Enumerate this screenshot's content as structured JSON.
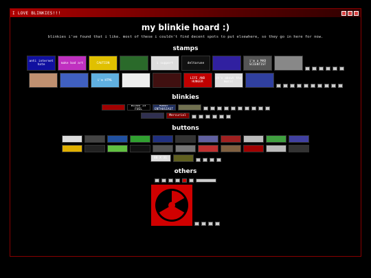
{
  "window": {
    "title": "I LOVE BLINKIES!!!"
  },
  "page": {
    "heading": "my blinkie hoard :)",
    "description": "blinkies i've found that i like. most of these i couldn't find decent spots to put elsewhere, so they go in here for now."
  },
  "sections": {
    "stamps": "stamps",
    "blinkies": "blinkies",
    "buttons": "buttons",
    "others": "others"
  },
  "stamps_row1": [
    {
      "text": "anti internet hate",
      "bg": "#1010a0"
    },
    {
      "text": "make bad art",
      "bg": "#c030c0"
    },
    {
      "text": "CAUTION",
      "bg": "#e0c000"
    },
    {
      "text": "",
      "bg": "#2a6a2a"
    },
    {
      "text": "i support",
      "bg": "#dddddd"
    },
    {
      "text": "deltarune",
      "bg": "#111"
    },
    {
      "text": "",
      "bg": "#3020a0"
    },
    {
      "text": "i'm a MAD SCIENTIST",
      "bg": "#555"
    },
    {
      "text": "",
      "bg": "#888"
    }
  ],
  "stamps_row2": [
    {
      "text": "",
      "bg": "#c09070"
    },
    {
      "text": "",
      "bg": "#4060c0"
    },
    {
      "text": "i'm HTML",
      "bg": "#60b0e0"
    },
    {
      "text": "",
      "bg": "#eee"
    },
    {
      "text": "",
      "bg": "#401010"
    },
    {
      "text": "LIFE AND HUNGER",
      "bg": "#c00000"
    },
    {
      "text": "it's about the music",
      "bg": "#e0e0e0"
    },
    {
      "text": "",
      "bg": "#3040a0"
    }
  ],
  "blinkies_row1": [
    {
      "text": "",
      "bg": "#a00000"
    },
    {
      "text": "BLOOD IS FUEL",
      "bg": "#000"
    },
    {
      "text": "ROBOT ENTHUSIAST",
      "bg": "#203060"
    },
    {
      "text": "",
      "bg": "#707050"
    }
  ],
  "blinkies_row2": [
    {
      "text": "",
      "bg": "#303050"
    },
    {
      "text": "Mercurial",
      "bg": "#800000"
    }
  ],
  "buttons_row1": [
    "#ddd",
    "#444",
    "#2050a0",
    "#30a030",
    "#203080",
    "#333",
    "#6060a0",
    "#a02020",
    "#bbb",
    "#40a040",
    "#4040a0"
  ],
  "buttons_row2": [
    "#e0b000",
    "#222",
    "#60c040",
    "#111",
    "#555",
    "#777",
    "#c03030",
    "#806040",
    "#a00000",
    "#bbb",
    "#333"
  ],
  "buttons_row3": [
    {
      "text": "88 X 31",
      "bg": "#ddd"
    },
    {
      "text": "",
      "bg": "#606020"
    }
  ],
  "others": {
    "big_icon": "radiation-icon"
  }
}
